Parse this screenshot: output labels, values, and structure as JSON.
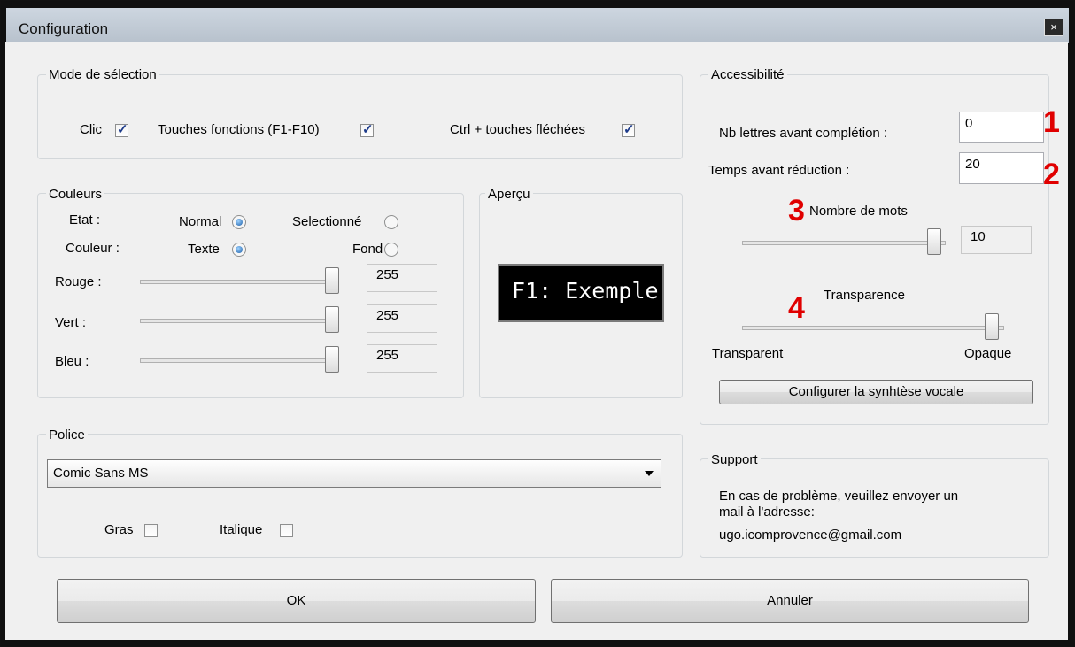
{
  "window": {
    "title": "Configuration",
    "close_glyph": "×"
  },
  "selection_mode": {
    "legend": "Mode de sélection",
    "clic": {
      "label": "Clic",
      "checked": true
    },
    "fkeys": {
      "label": "Touches fonctions (F1-F10)",
      "checked": true
    },
    "ctrl": {
      "label": "Ctrl + touches fléchées",
      "checked": true
    }
  },
  "colors": {
    "legend": "Couleurs",
    "etat_label": "Etat :",
    "normal_label": "Normal",
    "selected_label": "Selectionné",
    "couleur_label": "Couleur :",
    "texte_label": "Texte",
    "fond_label": "Fond",
    "rouge_label": "Rouge :",
    "rouge_value": "255",
    "vert_label": "Vert :",
    "vert_value": "255",
    "bleu_label": "Bleu :",
    "bleu_value": "255"
  },
  "preview": {
    "legend": "Aperçu",
    "text": "F1: Exemple"
  },
  "font": {
    "legend": "Police",
    "selected": "Comic Sans MS",
    "gras_label": "Gras",
    "italique_label": "Italique"
  },
  "accessibility": {
    "legend": "Accessibilité",
    "nb_lettres_label": "Nb lettres avant complétion :",
    "nb_lettres_value": "0",
    "temps_label": "Temps avant réduction :",
    "temps_value": "20",
    "nombre_mots_label": "Nombre de mots",
    "nombre_mots_value": "10",
    "transparence_label": "Transparence",
    "transparent_label": "Transparent",
    "opaque_label": "Opaque",
    "tts_button": "Configurer la synhtèse vocale"
  },
  "support": {
    "legend": "Support",
    "line1": "En cas de problème, veuillez envoyer un",
    "line2": "mail à l'adresse:",
    "line3": "ugo.icomprovence@gmail.com"
  },
  "buttons": {
    "ok": "OK",
    "cancel": "Annuler"
  },
  "annotations": {
    "m1": "1",
    "m2": "2",
    "m3": "3",
    "m4": "4"
  },
  "colors_theme": {
    "annotation": "#e00000",
    "preview_bg": "#000000"
  }
}
